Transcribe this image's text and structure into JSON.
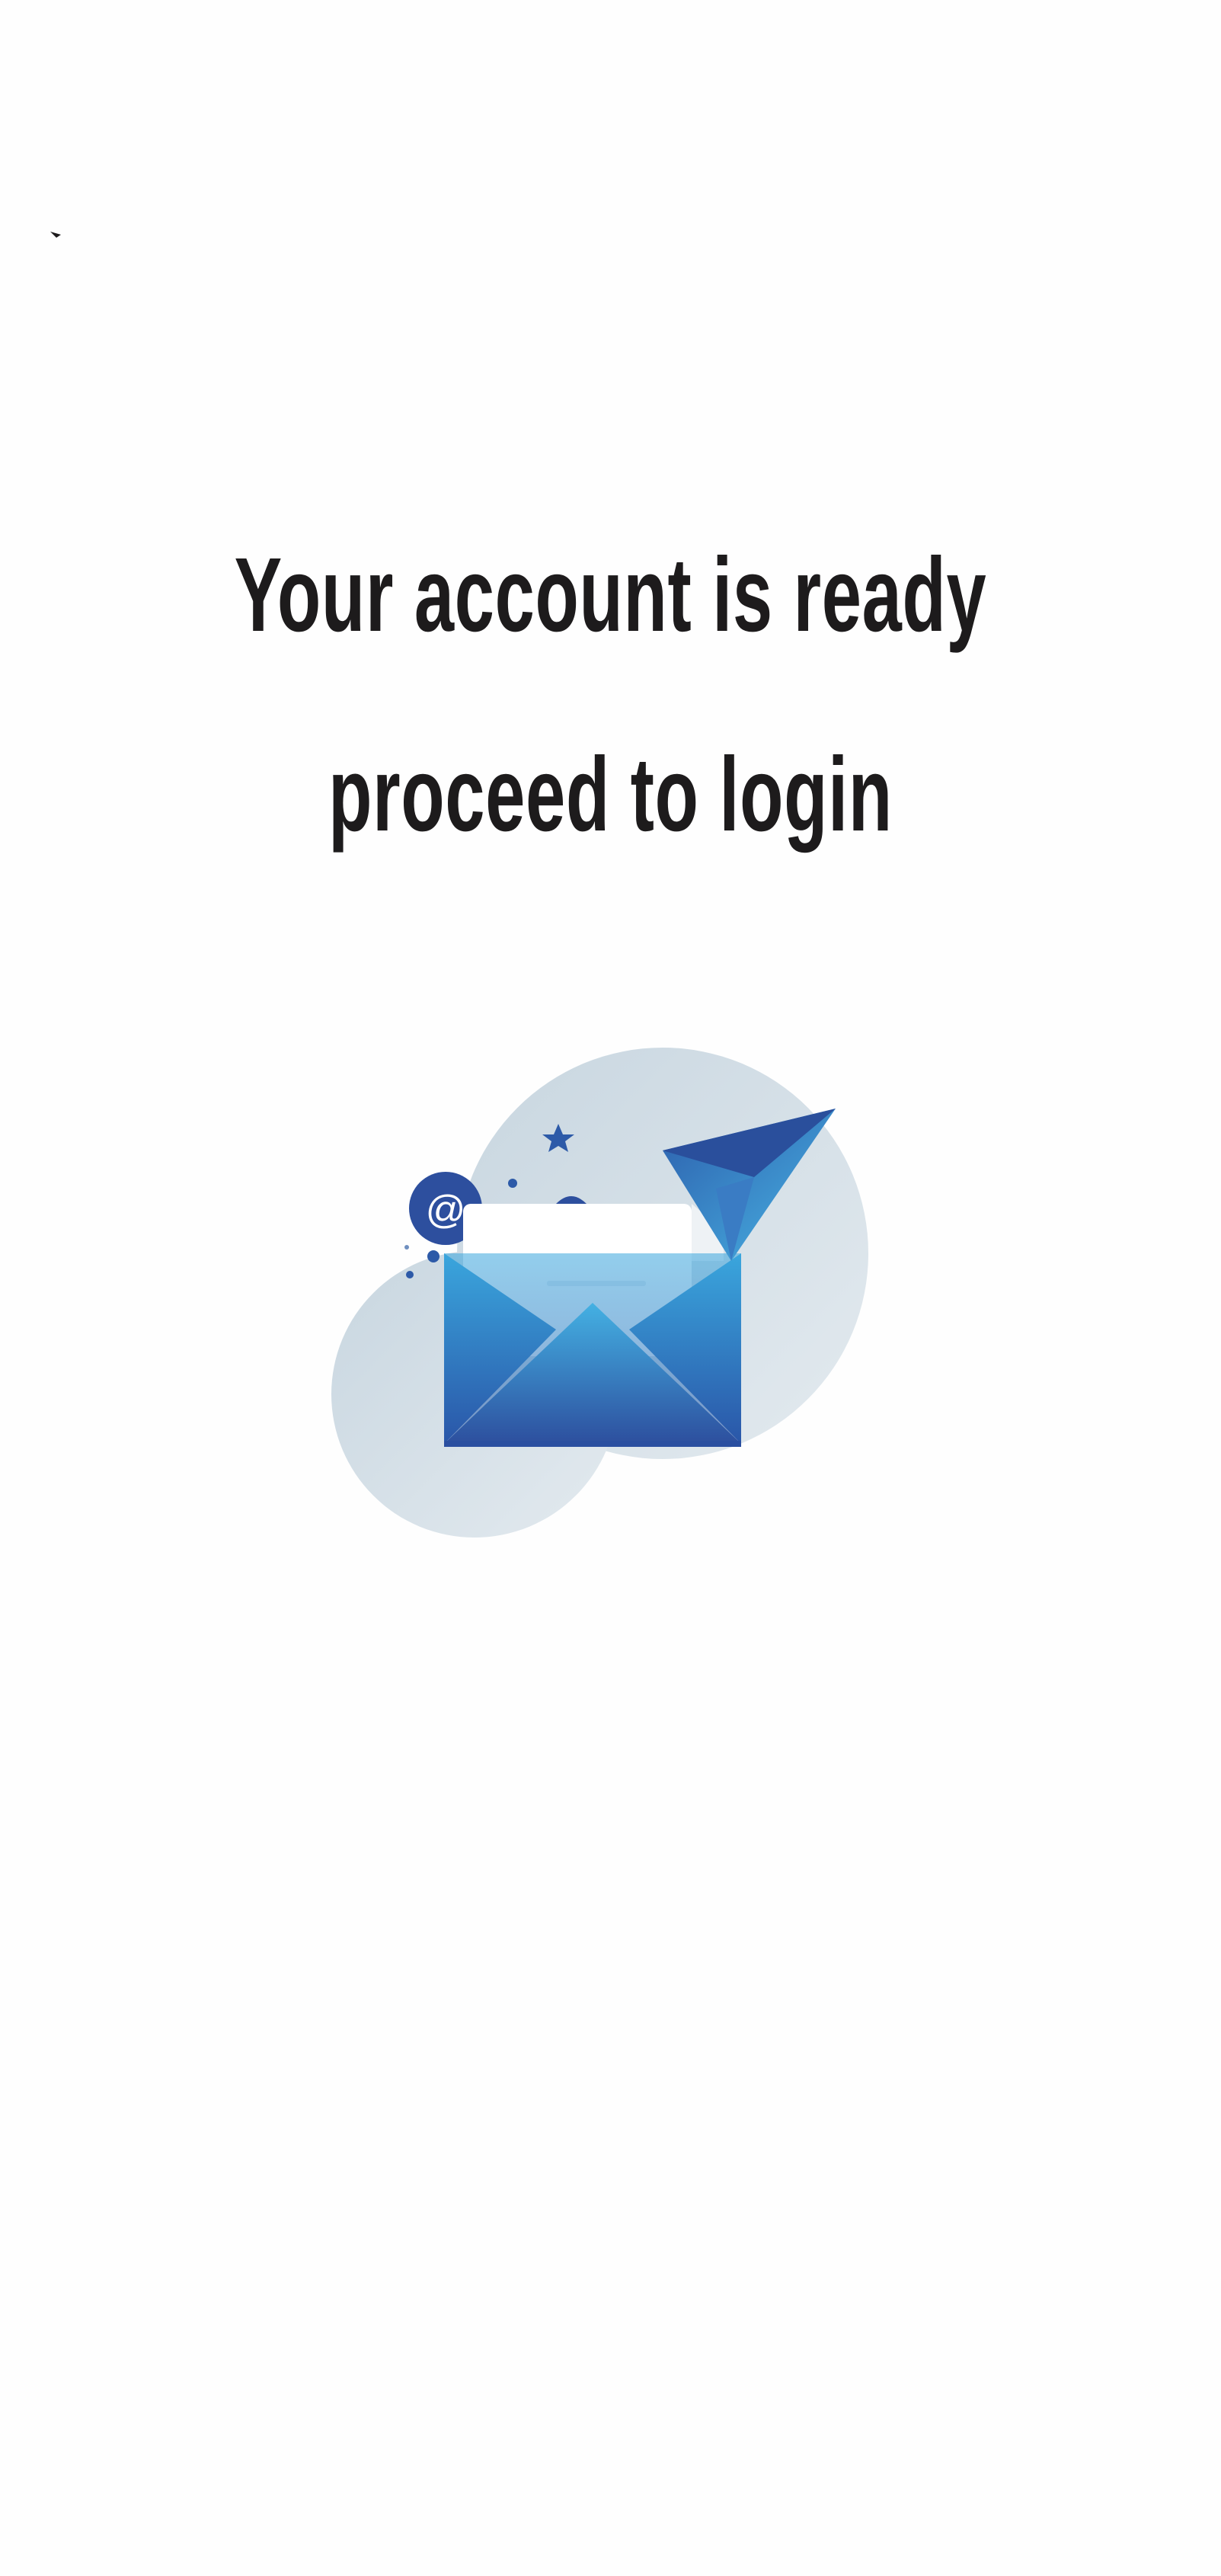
{
  "header": {
    "back_icon": "back-arrow-icon"
  },
  "main": {
    "headline": "Your account is ready proceed to login",
    "illustration": {
      "icon": "email-envelope-illustration",
      "at_symbol": "@"
    }
  },
  "colors": {
    "text": "#1d1b1c",
    "envelope_blue": "#2f8fd0",
    "envelope_dark": "#2a4fa0",
    "circle_bg": "#d3dee6",
    "background": "#fefefe"
  }
}
